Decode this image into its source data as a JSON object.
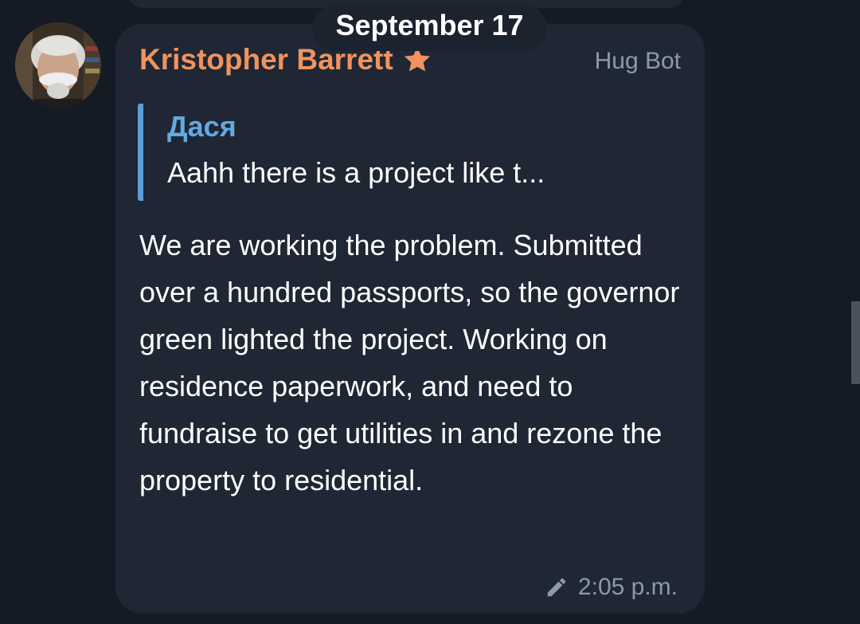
{
  "date_separator": "September 17",
  "message": {
    "sender_name": "Kristopher Barrett",
    "sender_badge_icon": "star-icon",
    "via_bot": "Hug Bot",
    "reply": {
      "author": "Дася",
      "preview": "Aahh there is a project like t..."
    },
    "text": "We are working the problem. Submitted over a hundred passports, so the governor green lighted the project. Working on residence paperwork, and need to fundraise to get utilities in and rezone the property to residential.",
    "edited_icon": "pencil-icon",
    "time": "2:05 p.m."
  },
  "colors": {
    "background": "#151b24",
    "bubble": "#1e2733",
    "sender_name": "#f0935e",
    "reply_accent": "#5b9fd8",
    "meta_text": "#8e9aa6"
  }
}
